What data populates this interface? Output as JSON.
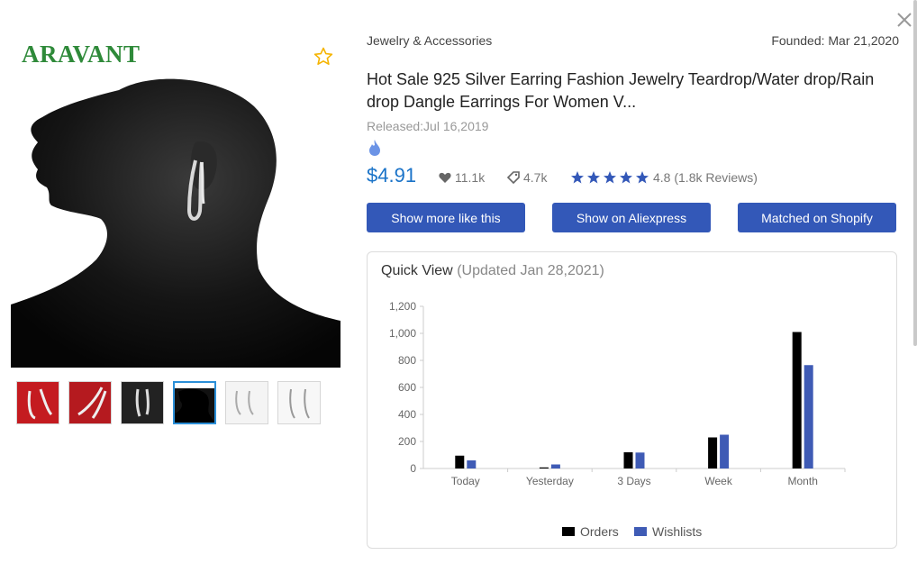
{
  "product": {
    "category": "Jewelry & Accessories",
    "founded": "Founded: Mar 21,2020",
    "title": "Hot Sale 925 Silver Earring Fashion Jewelry Teardrop/Water drop/Rain drop Dangle Earrings For Women V...",
    "released": "Released:Jul 16,2019",
    "price": "$4.91",
    "likes": "11.1k",
    "orders_tag": "4.7k",
    "rating_value": 4.8,
    "rating_text": "4.8 (1.8k Reviews)",
    "brand": "ARAVANT"
  },
  "buttons": {
    "show_more": "Show more like this",
    "show_aliexpress": "Show on Aliexpress",
    "matched_shopify": "Matched on Shopify"
  },
  "quick_view": {
    "title": "Quick View",
    "updated": "(Updated Jan 28,2021)"
  },
  "thumbnails": [
    {
      "bg": "#c41b20"
    },
    {
      "bg": "#b51a1f"
    },
    {
      "bg": "#222222"
    },
    {
      "bg": "#111111"
    },
    {
      "bg": "#f4f4f4"
    },
    {
      "bg": "#f7f7f7"
    }
  ],
  "colors": {
    "accent": "#1a73c8",
    "button": "#3358b8",
    "orders": "#000000",
    "wishlists": "#3f5bb5",
    "star": "#f5b400"
  },
  "chart_data": {
    "type": "bar",
    "categories": [
      "Today",
      "Yesterday",
      "3 Days",
      "Week",
      "Month"
    ],
    "series": [
      {
        "name": "Orders",
        "values": [
          95,
          8,
          120,
          230,
          1010
        ]
      },
      {
        "name": "Wishlists",
        "values": [
          60,
          30,
          118,
          250,
          765
        ]
      }
    ],
    "yticks": [
      "0",
      "200",
      "400",
      "600",
      "800",
      "1,000",
      "1,200"
    ],
    "ylim": [
      0,
      1200
    ],
    "legend": "bottom-center"
  }
}
